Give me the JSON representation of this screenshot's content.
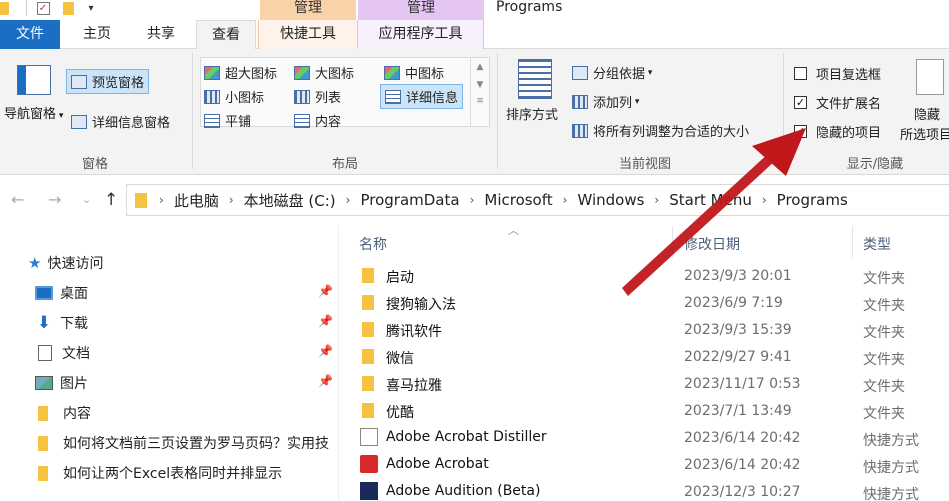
{
  "titlebar": {
    "context_tab_1": "管理",
    "context_tab_2": "管理",
    "window_title": "Programs"
  },
  "tabs": {
    "file": "文件",
    "home": "主页",
    "share": "共享",
    "view": "查看",
    "shortcut_tools": "快捷工具",
    "app_tools": "应用程序工具"
  },
  "ribbon": {
    "panes": {
      "nav_pane": "导航窗格",
      "preview_pane": "预览窗格",
      "details_pane": "详细信息窗格",
      "group_label": "窗格"
    },
    "layout": {
      "extra_large": "超大图标",
      "large": "大图标",
      "medium": "中图标",
      "small": "小图标",
      "list": "列表",
      "details": "详细信息",
      "tiles": "平铺",
      "content": "内容",
      "group_label": "布局"
    },
    "current_view": {
      "sort_by": "排序方式",
      "group_by": "分组依据",
      "add_columns": "添加列",
      "size_all_columns": "将所有列调整为合适的大小",
      "group_label": "当前视图"
    },
    "show_hide": {
      "item_checkboxes": "项目复选框",
      "file_extensions": "文件扩展名",
      "hidden_items": "隐藏的项目",
      "item_checkboxes_checked": false,
      "file_extensions_checked": true,
      "hidden_items_checked": true,
      "hide_selected_line1": "隐藏",
      "hide_selected_line2": "所选项目",
      "group_label": "显示/隐藏"
    }
  },
  "address": {
    "crumbs": [
      "此电脑",
      "本地磁盘 (C:)",
      "ProgramData",
      "Microsoft",
      "Windows",
      "Start Menu",
      "Programs"
    ]
  },
  "navpane": {
    "quick_access": "快速访问",
    "items": [
      {
        "label": "桌面",
        "pinned": true
      },
      {
        "label": "下载",
        "pinned": true
      },
      {
        "label": "文档",
        "pinned": true
      },
      {
        "label": "图片",
        "pinned": true
      },
      {
        "label": "内容",
        "pinned": false
      },
      {
        "label": "如何将文档前三页设置为罗马页码？实用技",
        "pinned": false
      },
      {
        "label": "如何让两个Excel表格同时并排显示",
        "pinned": false
      }
    ]
  },
  "filelist": {
    "columns": {
      "name": "名称",
      "date": "修改日期",
      "type": "类型"
    },
    "rows": [
      {
        "name": "启动",
        "date": "2023/9/3 20:01",
        "type": "文件夹",
        "icon": "folder-icon"
      },
      {
        "name": "搜狗输入法",
        "date": "2023/6/9 7:19",
        "type": "文件夹",
        "icon": "folder-icon"
      },
      {
        "name": "腾讯软件",
        "date": "2023/9/3 15:39",
        "type": "文件夹",
        "icon": "folder-icon"
      },
      {
        "name": "微信",
        "date": "2022/9/27 9:41",
        "type": "文件夹",
        "icon": "folder-icon"
      },
      {
        "name": "喜马拉雅",
        "date": "2023/11/17 0:53",
        "type": "文件夹",
        "icon": "folder-icon"
      },
      {
        "name": "优酷",
        "date": "2023/7/1 13:49",
        "type": "文件夹",
        "icon": "folder-icon"
      },
      {
        "name": "Adobe Acrobat Distiller",
        "date": "2023/6/14 20:42",
        "type": "快捷方式",
        "icon": "acrobat-distiller-icon"
      },
      {
        "name": "Adobe Acrobat",
        "date": "2023/6/14 20:42",
        "type": "快捷方式",
        "icon": "acrobat-icon"
      },
      {
        "name": "Adobe Audition (Beta)",
        "date": "2023/12/3 10:27",
        "type": "快捷方式",
        "icon": "audition-icon"
      }
    ]
  },
  "colors": {
    "file_tab": "#1a6fc4",
    "context_manage_1": "#f9d2a8",
    "context_manage_2": "#e5c6f3",
    "arrow": "#c0171b"
  }
}
